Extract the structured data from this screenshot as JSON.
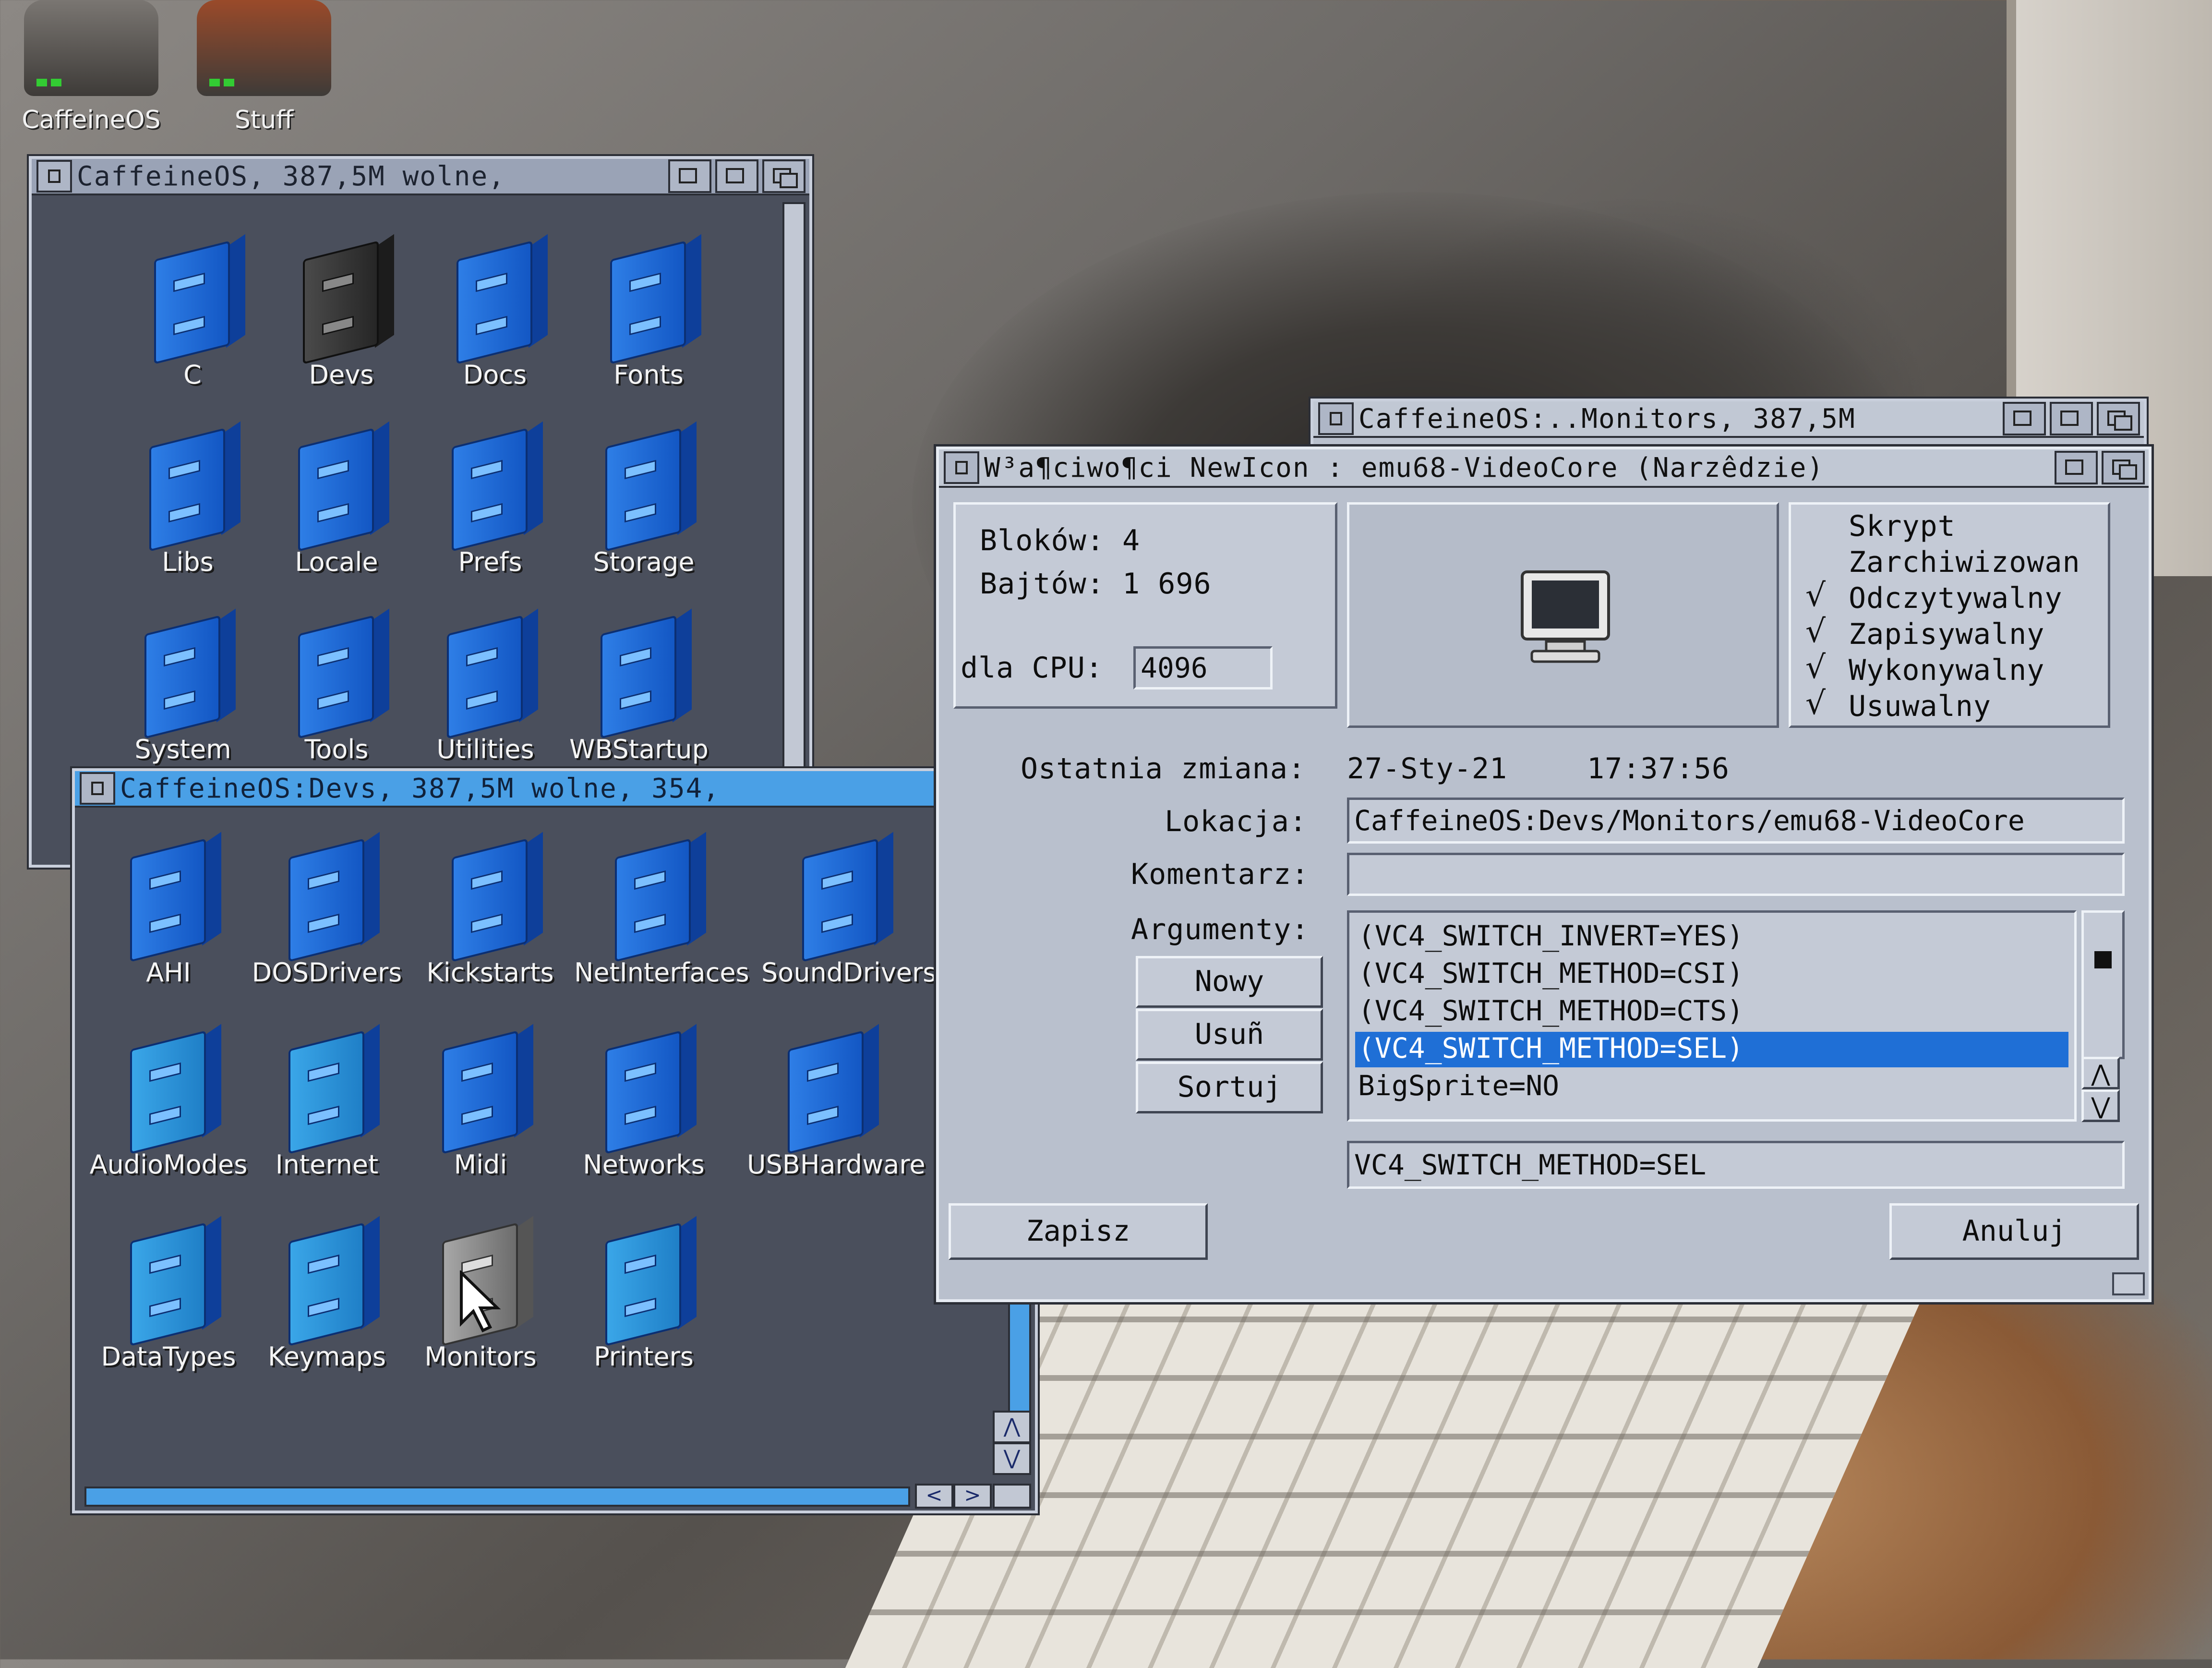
{
  "desktop": {
    "disks": [
      {
        "label": "CaffeineOS"
      },
      {
        "label": "Stuff"
      }
    ]
  },
  "window_root": {
    "title": "CaffeineOS,  387,5M wolne,",
    "icons": [
      {
        "label": "C"
      },
      {
        "label": "Devs"
      },
      {
        "label": "Docs"
      },
      {
        "label": "Fonts"
      },
      {
        "label": "Libs"
      },
      {
        "label": "Locale"
      },
      {
        "label": "Prefs"
      },
      {
        "label": "Storage"
      },
      {
        "label": "System"
      },
      {
        "label": "Tools"
      },
      {
        "label": "Utilities"
      },
      {
        "label": "WBStartup"
      }
    ]
  },
  "window_devs": {
    "title": "CaffeineOS:Devs,  387,5M wolne, 354,",
    "icons": [
      {
        "label": "AHI"
      },
      {
        "label": "DOSDrivers"
      },
      {
        "label": "Kickstarts"
      },
      {
        "label": "NetInterfaces"
      },
      {
        "label": "SoundDrivers"
      },
      {
        "label": "AudioModes"
      },
      {
        "label": "Internet"
      },
      {
        "label": "Midi"
      },
      {
        "label": "Networks"
      },
      {
        "label": "USBHardware"
      },
      {
        "label": "DataTypes"
      },
      {
        "label": "Keymaps"
      },
      {
        "label": "Monitors"
      },
      {
        "label": "Printers"
      }
    ],
    "scroll_up": "⋀",
    "scroll_down": "⋁",
    "scroll_left": "<",
    "scroll_right": ">"
  },
  "window_monitors": {
    "title": "CaffeineOS:..Monitors,  387,5M"
  },
  "dialog": {
    "title": "W³a¶ciwo¶ci NewIcon : emu68-VideoCore (Narzêdzie)",
    "blocks_label": "Bloków: 4",
    "bytes_label": "Bajtów: 1 696",
    "cpu_label": "dla CPU:",
    "cpu_value": "4096",
    "modified_label": "Ostatnia zmiana:",
    "modified_date": "27-Sty-21",
    "modified_time": "17:37:56",
    "location_label": "Lokacja:",
    "location_value": "CaffeineOS:Devs/Monitors/emu68-VideoCore",
    "comment_label": "Komentarz:",
    "comment_value": "",
    "arguments_label": "Argumenty:",
    "flags": [
      {
        "label": "Skrypt",
        "checked": false
      },
      {
        "label": "Zarchiwizowan",
        "checked": false
      },
      {
        "label": "Odczytywalny",
        "checked": true
      },
      {
        "label": "Zapisywalny",
        "checked": true
      },
      {
        "label": "Wykonywalny",
        "checked": true
      },
      {
        "label": "Usuwalny",
        "checked": true
      }
    ],
    "check_glyph": "√",
    "arguments": [
      {
        "text": "(VC4_SWITCH_INVERT=YES)",
        "selected": false
      },
      {
        "text": "(VC4_SWITCH_METHOD=CSI)",
        "selected": false
      },
      {
        "text": "(VC4_SWITCH_METHOD=CTS)",
        "selected": false
      },
      {
        "text": "(VC4_SWITCH_METHOD=SEL)",
        "selected": true
      },
      {
        "text": "BigSprite=NO",
        "selected": false
      }
    ],
    "argument_edit_value": "VC4_SWITCH_METHOD=SEL",
    "btn_new": "Nowy",
    "btn_remove": "Usuñ",
    "btn_sort": "Sortuj",
    "btn_save": "Zapisz",
    "btn_cancel": "Anuluj",
    "list_up": "⋀",
    "list_down": "⋁"
  }
}
